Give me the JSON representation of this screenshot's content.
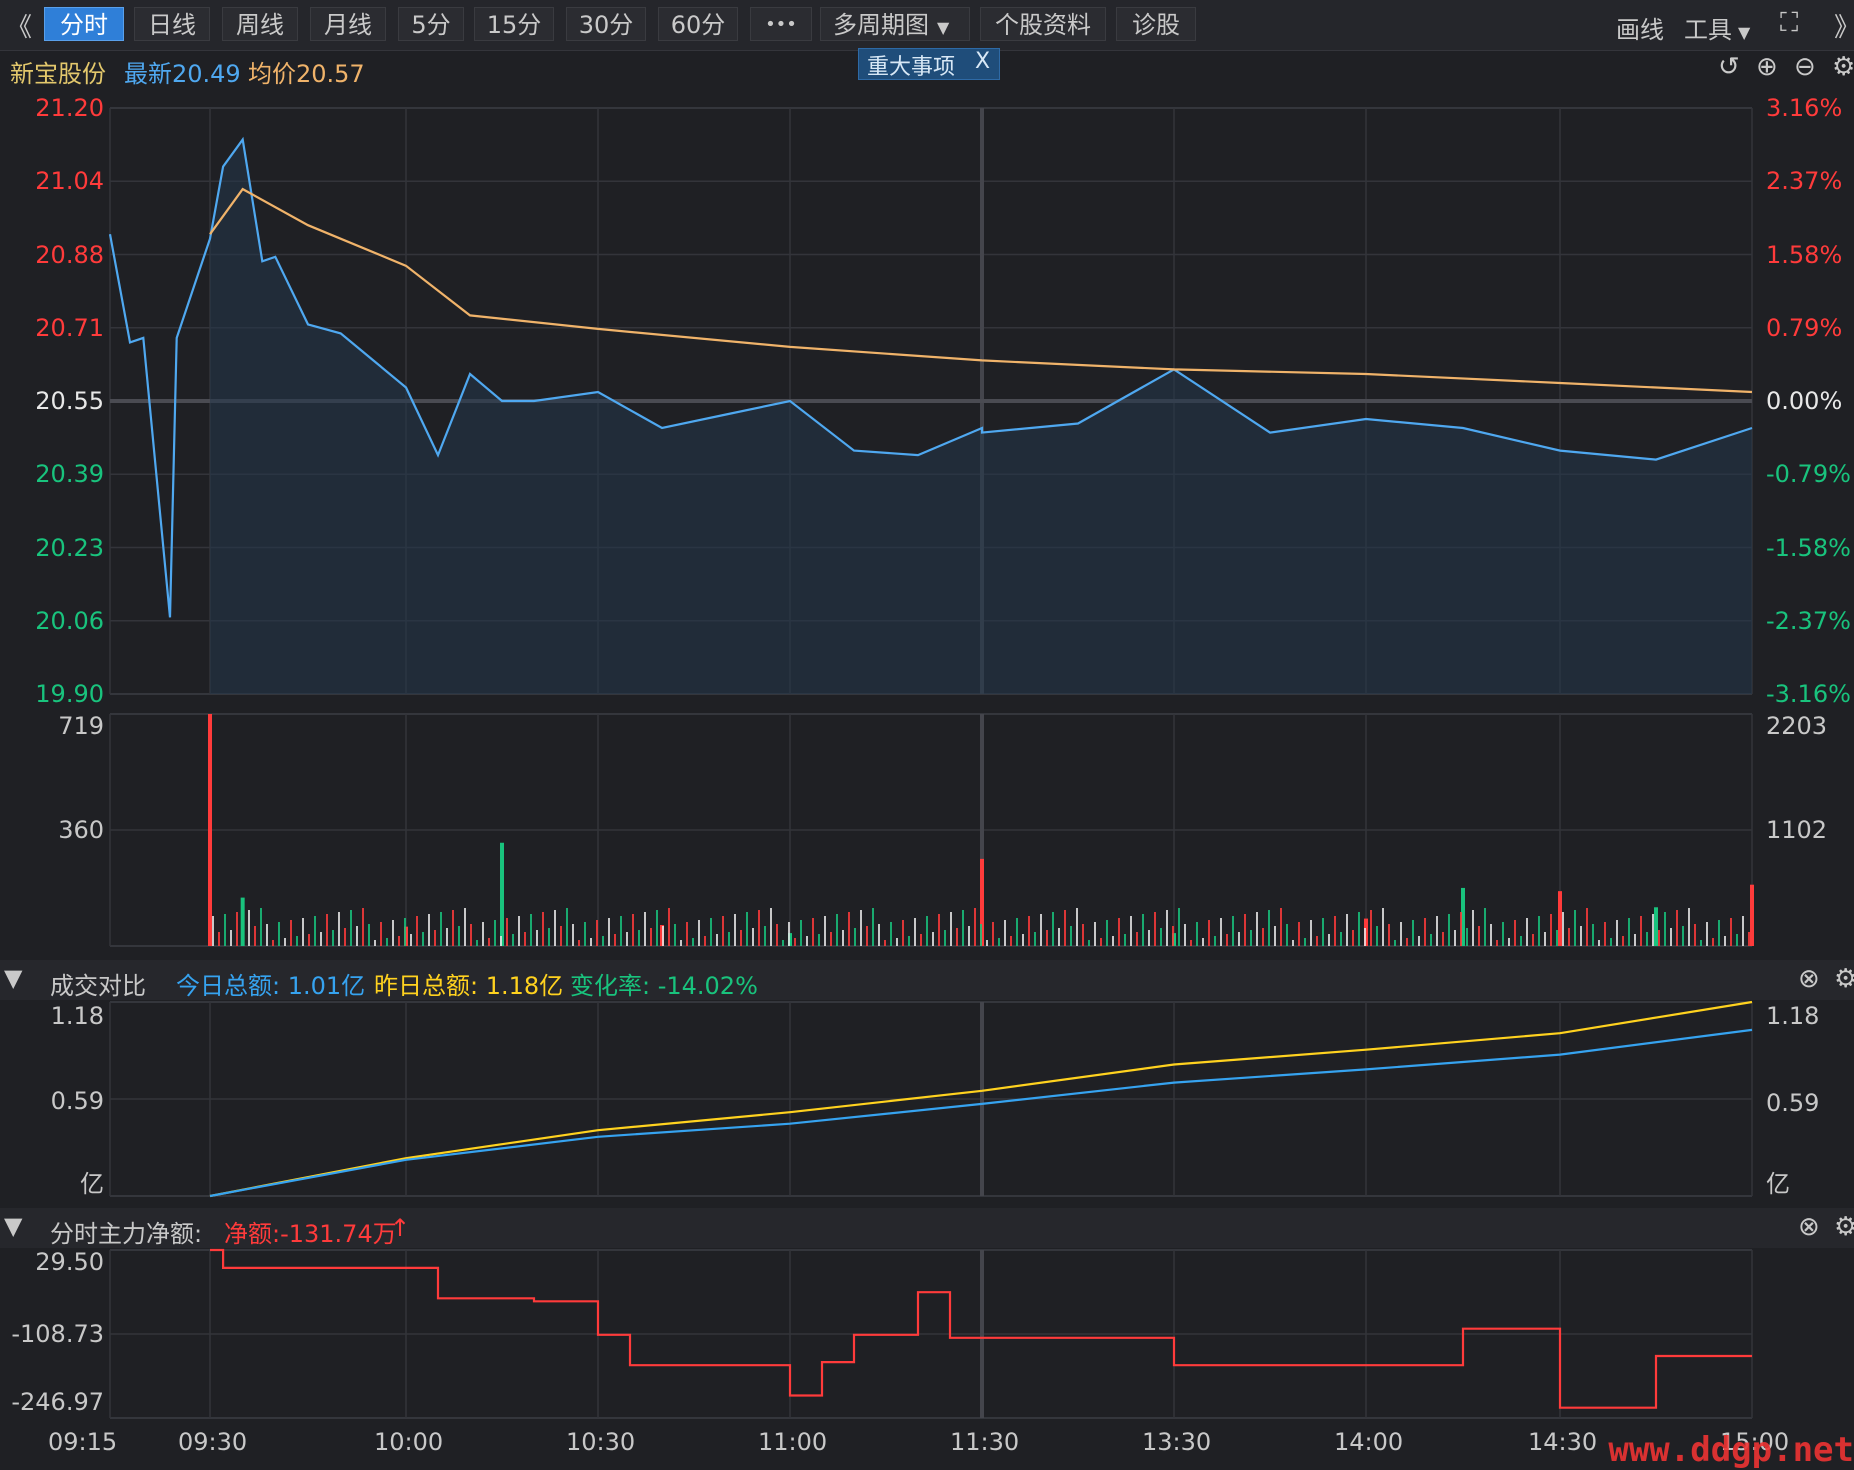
{
  "toolbar": {
    "collapse_label": "《",
    "tabs": [
      "分时",
      "日线",
      "周线",
      "月线",
      "5分",
      "15分",
      "30分",
      "60分"
    ],
    "more_label": "•••",
    "multi_period_label": "多周期图",
    "profile_label": "个股资料",
    "diagnose_label": "诊股",
    "draw_label": "画线",
    "tools_label": "工具",
    "expand_label": "》"
  },
  "stock": {
    "name": "新宝股份",
    "latest": "最新20.49",
    "avg": "均价20.57",
    "event_label": "重大事项",
    "event_close": "X"
  },
  "price_axis": {
    "left": [
      "21.20",
      "21.04",
      "20.88",
      "20.71",
      "20.55",
      "20.39",
      "20.23",
      "20.06",
      "19.90"
    ],
    "right": [
      "3.16%",
      "2.37%",
      "1.58%",
      "0.79%",
      "0.00%",
      "-0.79%",
      "-1.58%",
      "-2.37%",
      "-3.16%"
    ]
  },
  "volume_axis": {
    "left": [
      "719",
      "360"
    ],
    "right": [
      "2203",
      "1102"
    ]
  },
  "turnover_panel": {
    "title": "成交对比",
    "today": "今日总额: 1.01亿",
    "yesterday": "昨日总额: 1.18亿",
    "change": "变化率: -14.02%",
    "left": [
      "1.18",
      "0.59",
      "亿"
    ],
    "right": [
      "1.18",
      "0.59",
      "亿"
    ]
  },
  "netflow_panel": {
    "title": "分时主力净额:",
    "net": "净额:-131.74万",
    "arrow": "↑",
    "left": [
      "29.50",
      "-108.73",
      "-246.97"
    ]
  },
  "time_axis": [
    "09:15",
    "09:30",
    "10:00",
    "10:30",
    "11:00",
    "11:30",
    "13:30",
    "14:00",
    "14:30",
    "15:00"
  ],
  "watermark": "www.ddgp.net",
  "colors": {
    "up": "#ff3b3b",
    "down": "#19c37d",
    "price": "#4fa8f0",
    "avg": "#f0b36a",
    "yesterday": "#ffd21f",
    "today": "#36a3f0",
    "flat": "#e6e6e6"
  },
  "chart_data": [
    {
      "type": "line",
      "title": "",
      "series": [
        {
          "name": "最新",
          "x": [
            "09:15",
            "09:18",
            "09:20",
            "09:24",
            "09:25",
            "09:30",
            "09:32",
            "09:35",
            "09:38",
            "09:40",
            "09:45",
            "09:50",
            "09:55",
            "10:00",
            "10:05",
            "10:10",
            "10:15",
            "10:20",
            "10:30",
            "10:40",
            "10:50",
            "11:00",
            "11:10",
            "11:20",
            "11:30",
            "13:00",
            "13:15",
            "13:30",
            "13:45",
            "14:00",
            "14:15",
            "14:30",
            "14:45",
            "15:00"
          ],
          "y": [
            20.92,
            20.68,
            20.69,
            20.07,
            20.69,
            20.91,
            21.07,
            21.13,
            20.86,
            20.87,
            20.72,
            20.7,
            20.64,
            20.58,
            20.43,
            20.61,
            20.55,
            20.55,
            20.57,
            20.49,
            20.52,
            20.55,
            20.44,
            20.43,
            20.49,
            20.48,
            20.5,
            20.62,
            20.48,
            20.51,
            20.49,
            20.44,
            20.42,
            20.49
          ]
        },
        {
          "name": "均价",
          "x": [
            "09:30",
            "09:35",
            "09:45",
            "10:00",
            "10:10",
            "10:30",
            "11:00",
            "11:30",
            "13:30",
            "14:00",
            "14:30",
            "15:00"
          ],
          "y": [
            20.92,
            21.02,
            20.94,
            20.85,
            20.74,
            20.71,
            20.67,
            20.64,
            20.62,
            20.61,
            20.59,
            20.57
          ]
        }
      ],
      "ylim": [
        19.9,
        21.2
      ]
    },
    {
      "type": "bar",
      "title": "",
      "x": [
        "09:30",
        "09:35",
        "10:00",
        "10:15",
        "10:40",
        "11:00",
        "11:45",
        "13:30",
        "14:00",
        "14:15",
        "14:30",
        "14:45",
        "15:00"
      ],
      "values": [
        719,
        150,
        60,
        320,
        65,
        40,
        270,
        40,
        85,
        180,
        170,
        120,
        190
      ],
      "ylim": [
        0,
        719
      ]
    },
    {
      "type": "line",
      "title": "成交对比",
      "series": [
        {
          "name": "昨日总额",
          "x": [
            "09:30",
            "10:00",
            "10:30",
            "11:00",
            "11:30",
            "13:30",
            "14:00",
            "14:30",
            "15:00"
          ],
          "y": [
            0,
            0.23,
            0.4,
            0.51,
            0.64,
            0.8,
            0.89,
            0.99,
            1.18
          ]
        },
        {
          "name": "今日总额",
          "x": [
            "09:30",
            "10:00",
            "10:30",
            "11:00",
            "11:30",
            "13:30",
            "14:00",
            "14:30",
            "15:00"
          ],
          "y": [
            0,
            0.22,
            0.36,
            0.44,
            0.56,
            0.69,
            0.77,
            0.86,
            1.01
          ]
        }
      ],
      "ylim": [
        0,
        1.18
      ]
    },
    {
      "type": "line",
      "title": "分时主力净额:",
      "series": [
        {
          "name": "主力净额",
          "x": [
            "09:30",
            "09:32",
            "09:58",
            "10:05",
            "10:20",
            "10:30",
            "10:35",
            "11:00",
            "11:05",
            "11:10",
            "11:20",
            "11:25",
            "11:30",
            "13:30",
            "14:00",
            "14:15",
            "14:30",
            "14:45",
            "15:00"
          ],
          "y": [
            29.5,
            0,
            0,
            -50,
            -55,
            -110,
            -160,
            -210,
            -155,
            -110,
            -40,
            -115,
            -115,
            -160,
            -160,
            -100,
            -230,
            -145,
            -145
          ]
        }
      ],
      "ylim": [
        -246.97,
        29.5
      ]
    }
  ]
}
